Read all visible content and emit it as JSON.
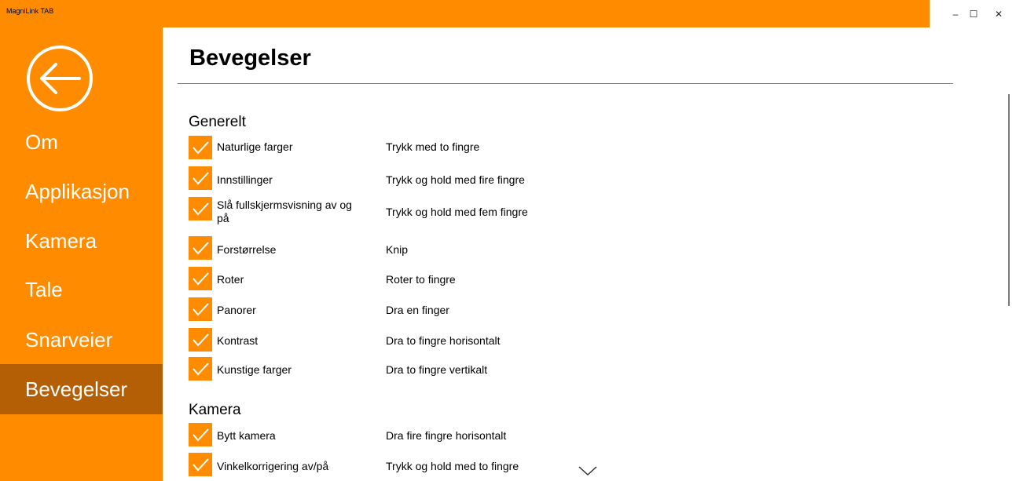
{
  "window": {
    "app_title": "MagniLink TAB",
    "minimize_glyph": "–",
    "maximize_glyph": "☐",
    "close_glyph": "✕"
  },
  "sidebar": {
    "back_icon": "arrow-left-circle-icon",
    "items": [
      {
        "label": "Om",
        "selected": false
      },
      {
        "label": "Applikasjon",
        "selected": false
      },
      {
        "label": "Kamera",
        "selected": false
      },
      {
        "label": "Tale",
        "selected": false
      },
      {
        "label": "Snarveier",
        "selected": false
      },
      {
        "label": "Bevegelser",
        "selected": true
      }
    ]
  },
  "main": {
    "title": "Bevegelser",
    "sections": [
      {
        "title": "Generelt",
        "rows": [
          {
            "label": "Naturlige farger",
            "gesture": "Trykk med to fingre",
            "checked": true
          },
          {
            "label": "Innstillinger",
            "gesture": "Trykk og hold med fire fingre",
            "checked": true
          },
          {
            "label": "Slå fullskjermsvisning av og på",
            "gesture": "Trykk og hold med fem fingre",
            "checked": true
          },
          {
            "label": "Forstørrelse",
            "gesture": "Knip",
            "checked": true
          },
          {
            "label": "Roter",
            "gesture": "Roter to fingre",
            "checked": true
          },
          {
            "label": "Panorer",
            "gesture": "Dra en finger",
            "checked": true
          },
          {
            "label": "Kontrast",
            "gesture": "Dra to fingre horisontalt",
            "checked": true
          },
          {
            "label": "Kunstige farger",
            "gesture": "Dra to fingre vertikalt",
            "checked": true
          }
        ]
      },
      {
        "title": "Kamera",
        "rows": [
          {
            "label": "Bytt kamera",
            "gesture": "Dra fire fingre horisontalt",
            "checked": true
          },
          {
            "label": "Vinkelkorrigering av/på",
            "gesture": "Trykk og hold med to fingre",
            "checked": true
          }
        ]
      }
    ]
  },
  "colors": {
    "accent": "#FF8C00",
    "selected_nav": "#B45F06"
  }
}
